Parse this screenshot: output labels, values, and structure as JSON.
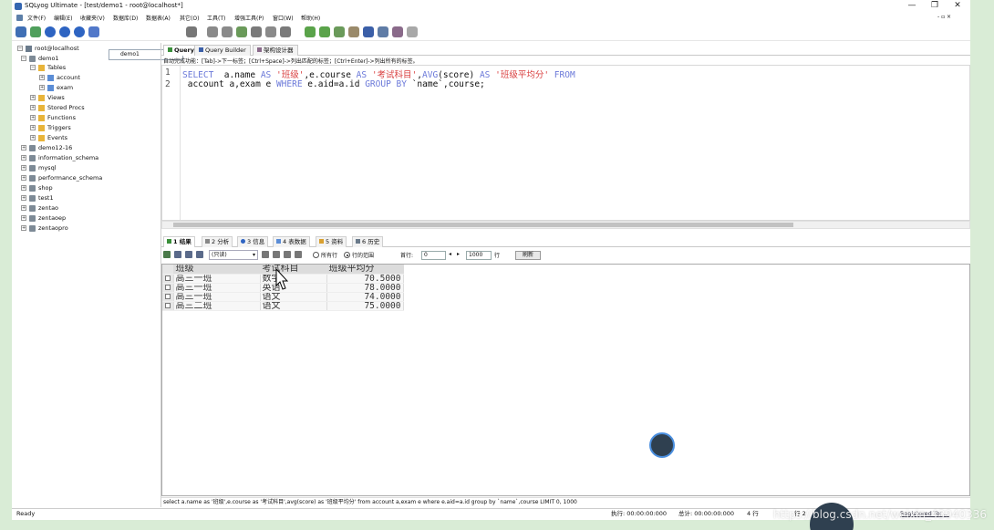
{
  "window": {
    "title": "SQLyog Ultimate - [test/demo1 - root@localhost*]",
    "minimize": "—",
    "maximize": "❐",
    "close": "✕",
    "restore_inner": "- ▫ ×"
  },
  "menu": [
    "文件(F)",
    "编辑(E)",
    "收藏夹(V)",
    "数据库(D)",
    "数据表(A)",
    "其它(O)",
    "工具(T)",
    "增强工具(P)",
    "窗口(W)",
    "帮助(H)"
  ],
  "toolbar": {
    "db_select_value": "demo1"
  },
  "tree": {
    "root": "root@localhost",
    "demo1": "demo1",
    "tables": "Tables",
    "account": "account",
    "exam": "exam",
    "views": "Views",
    "stored_procs": "Stored Procs",
    "functions": "Functions",
    "triggers": "Triggers",
    "events": "Events",
    "databases": [
      "demo12-16",
      "information_schema",
      "mysql",
      "performance_schema",
      "shop",
      "test1",
      "zentao",
      "zentaoep",
      "zentaopro"
    ]
  },
  "editor_tabs": {
    "query": "Query",
    "query_builder": "Query Builder",
    "schema_designer": "架构设计器"
  },
  "hint": "自动完成功能：[Tab]->下一标签；[Ctrl+Space]->列出匹配的标签；[Ctrl+Enter]->列出所有的标签。",
  "editor": {
    "line1": "1",
    "line2": "2",
    "l1_select": "SELECT",
    "l1_a": "  a.name ",
    "l1_as1": "AS",
    "l1_s1": " '班级'",
    "l1_b": ",e.course ",
    "l1_as2": "AS",
    "l1_s2": " '考试科目'",
    "l1_c": ",",
    "l1_avg": "AVG",
    "l1_d": "(score) ",
    "l1_as3": "AS",
    "l1_s3": " '班级平均分'",
    "l1_from": " FROM",
    "l2_a": " account a,exam e ",
    "l2_where": "WHERE",
    "l2_b": " e.aid=a.id ",
    "l2_groupby": "GROUP BY",
    "l2_c": " `name`,course;"
  },
  "result_tabs": [
    "1 结果",
    "2 分析",
    "3 信息",
    "4 表数据",
    "5 资料",
    "6 历史"
  ],
  "result_toolbar": {
    "readonly": "(只读)",
    "all_rows": "所有行",
    "row_range": "行的范围",
    "first_row_label": "首行:",
    "first_row_value": "0",
    "rows_value": "1000",
    "rows_label": "行",
    "refresh": "刷新"
  },
  "grid": {
    "headers": [
      "班级",
      "考试科目",
      "班级平均分"
    ],
    "rows": [
      [
        "高三一班",
        "数学",
        "70.5000"
      ],
      [
        "高三一班",
        "英语",
        "78.0000"
      ],
      [
        "高三一班",
        "语文",
        "74.0000"
      ],
      [
        "高三二班",
        "语文",
        "75.0000"
      ]
    ]
  },
  "sql_bar": "select  a.name as '班级',e.course as '考试科目',avg(score) as '班级平均分' from   account a,exam e where e.aid=a.id group by `name`,course LIMIT 0, 1000",
  "status": {
    "ready": "Ready",
    "exec_time": "执行: 00:00:00:000",
    "total_time": "总计: 00:00:00:000",
    "rows": "4 行",
    "line": "行 2",
    "register": "Registered To: ..."
  },
  "watermark": "https://blog.csdn.net/weixin_43940336"
}
